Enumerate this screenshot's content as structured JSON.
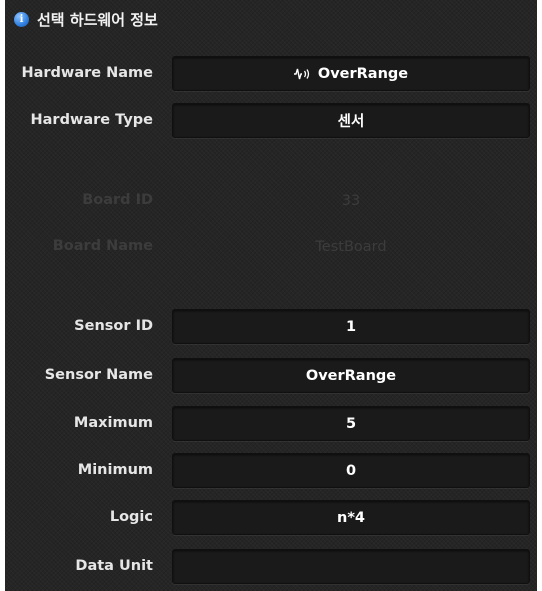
{
  "header": {
    "title": "선택 하드웨어 정보",
    "icon": "info-icon"
  },
  "rows": {
    "hardware_name": {
      "label": "Hardware Name",
      "value": "OverRange",
      "icon": "sensor-signal-icon"
    },
    "hardware_type": {
      "label": "Hardware Type",
      "value": "센서"
    },
    "board_id": {
      "label": "Board ID",
      "value": "33"
    },
    "board_name": {
      "label": "Board Name",
      "value": "TestBoard"
    },
    "sensor_id": {
      "label": "Sensor ID",
      "value": "1"
    },
    "sensor_name": {
      "label": "Sensor Name",
      "value": "OverRange"
    },
    "maximum": {
      "label": "Maximum",
      "value": "5"
    },
    "minimum": {
      "label": "Minimum",
      "value": "0"
    },
    "logic": {
      "label": "Logic",
      "value": "n*4"
    },
    "data_unit": {
      "label": "Data Unit",
      "value": ""
    }
  },
  "colors": {
    "panel_bg": "#252525",
    "field_bg": "#1a1a1a",
    "text": "#e6e6e6",
    "disabled_text": "#3c3c3c",
    "info_icon": "#2f7fe0"
  }
}
